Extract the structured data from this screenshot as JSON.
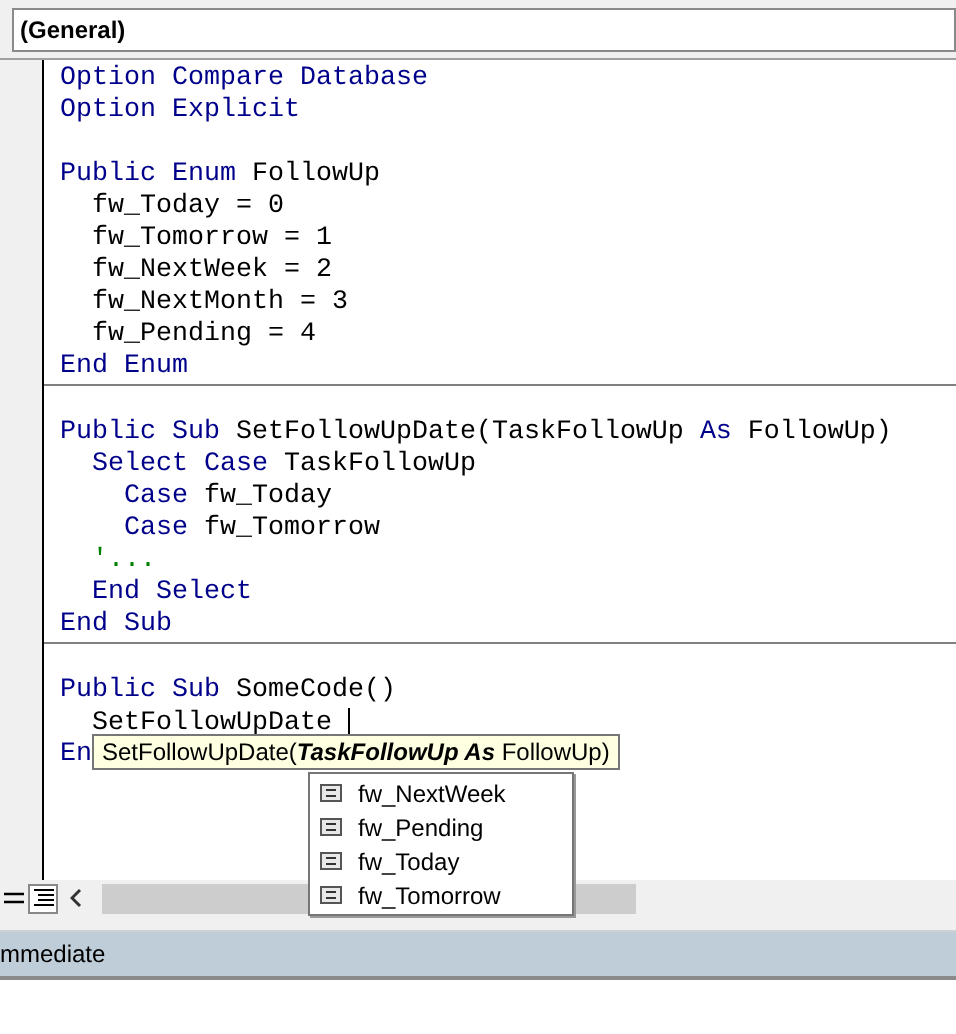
{
  "object_dropdown": {
    "value": "(General)"
  },
  "code_sections": [
    {
      "lines": [
        {
          "kind": "code",
          "tokens": [
            {
              "text": "Option Compare Database",
              "kind": "keyword"
            }
          ]
        },
        {
          "kind": "code",
          "tokens": [
            {
              "text": "Option Explicit",
              "kind": "keyword"
            }
          ]
        },
        {
          "kind": "blank"
        },
        {
          "kind": "code",
          "tokens": [
            {
              "text": "Public Enum",
              "kind": "keyword"
            },
            {
              "text": " FollowUp",
              "kind": "plain"
            }
          ]
        },
        {
          "kind": "code",
          "tokens": [
            {
              "text": "  fw_Today = 0",
              "kind": "plain"
            }
          ]
        },
        {
          "kind": "code",
          "tokens": [
            {
              "text": "  fw_Tomorrow = 1",
              "kind": "plain"
            }
          ]
        },
        {
          "kind": "code",
          "tokens": [
            {
              "text": "  fw_NextWeek = 2",
              "kind": "plain"
            }
          ]
        },
        {
          "kind": "code",
          "tokens": [
            {
              "text": "  fw_NextMonth = 3",
              "kind": "plain"
            }
          ]
        },
        {
          "kind": "code",
          "tokens": [
            {
              "text": "  fw_Pending = 4",
              "kind": "plain"
            }
          ]
        },
        {
          "kind": "code",
          "tokens": [
            {
              "text": "End Enum",
              "kind": "keyword"
            }
          ]
        }
      ]
    },
    {
      "lines": [
        {
          "kind": "blank"
        },
        {
          "kind": "code",
          "tokens": [
            {
              "text": "Public Sub",
              "kind": "keyword"
            },
            {
              "text": " SetFollowUpDate(TaskFollowUp ",
              "kind": "plain"
            },
            {
              "text": "As",
              "kind": "keyword"
            },
            {
              "text": " FollowUp)",
              "kind": "plain"
            }
          ]
        },
        {
          "kind": "code",
          "tokens": [
            {
              "text": "  Select Case",
              "kind": "keyword"
            },
            {
              "text": " TaskFollowUp",
              "kind": "plain"
            }
          ]
        },
        {
          "kind": "code",
          "tokens": [
            {
              "text": "    Case",
              "kind": "keyword"
            },
            {
              "text": " fw_Today",
              "kind": "plain"
            }
          ]
        },
        {
          "kind": "code",
          "tokens": [
            {
              "text": "    Case",
              "kind": "keyword"
            },
            {
              "text": " fw_Tomorrow",
              "kind": "plain"
            }
          ]
        },
        {
          "kind": "code",
          "tokens": [
            {
              "text": "  '...",
              "kind": "comment"
            }
          ]
        },
        {
          "kind": "code",
          "tokens": [
            {
              "text": "  End Select",
              "kind": "keyword"
            }
          ]
        },
        {
          "kind": "code",
          "tokens": [
            {
              "text": "End Sub",
              "kind": "keyword"
            }
          ]
        }
      ]
    },
    {
      "lines": [
        {
          "kind": "blank"
        },
        {
          "kind": "code",
          "tokens": [
            {
              "text": "Public Sub",
              "kind": "keyword"
            },
            {
              "text": " SomeCode()",
              "kind": "plain"
            }
          ]
        },
        {
          "kind": "code",
          "tokens": [
            {
              "text": "  SetFollowUpDate ",
              "kind": "plain"
            }
          ]
        },
        {
          "kind": "code",
          "tokens": [
            {
              "text": "En",
              "kind": "keyword"
            }
          ]
        }
      ]
    }
  ],
  "parameter_tooltip": [
    {
      "text": "SetFollowUpDate(",
      "current": false
    },
    {
      "text": "TaskFollowUp As",
      "current": true
    },
    {
      "text": " FollowUp)",
      "current": false
    }
  ],
  "completion_list": [
    {
      "label": "fw_NextWeek"
    },
    {
      "label": "fw_Pending"
    },
    {
      "label": "fw_Today"
    },
    {
      "label": "fw_Tomorrow"
    }
  ],
  "immediate_panel": {
    "title": "mmediate"
  }
}
